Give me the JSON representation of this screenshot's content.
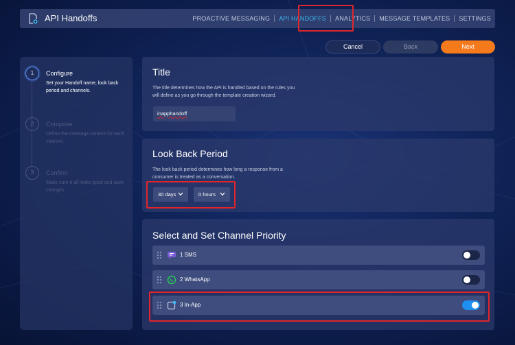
{
  "app": {
    "title": "API Handoffs",
    "icon": "document-plus-icon"
  },
  "nav": {
    "items": [
      {
        "label": "PROACTIVE MESSAGING",
        "active": false
      },
      {
        "label": "API HANDOFFS",
        "active": true
      },
      {
        "label": "ANALYTICS",
        "active": false
      },
      {
        "label": "MESSAGE TEMPLATES",
        "active": false
      },
      {
        "label": "SETTINGS",
        "active": false
      }
    ]
  },
  "actions": {
    "cancel": "Cancel",
    "back": "Back",
    "next": "Next"
  },
  "steps": [
    {
      "number": "1",
      "title": "Configure",
      "description": "Set your Handoff name, look back period and channels.",
      "active": true
    },
    {
      "number": "2",
      "title": "Compose",
      "description": "Define the message content for each channel.",
      "active": false
    },
    {
      "number": "3",
      "title": "Confirm",
      "description": "Make sure it all looks good and save changes.",
      "active": false
    }
  ],
  "title_card": {
    "heading": "Title",
    "description": "The title determines how the API is handled based on the rules you will define as you go through the template creation wizard.",
    "value": "inapphandoff"
  },
  "lookback_card": {
    "heading": "Look Back Period",
    "description": "The look back period determines how long a response from a consumer is treated as a conversation.",
    "days": "30 days",
    "hours": "0 hours"
  },
  "channels_card": {
    "heading": "Select and Set Channel Priority",
    "channels": [
      {
        "label": "1 SMS",
        "icon": "sms-chat-icon",
        "enabled": false
      },
      {
        "label": "2 WhatsApp",
        "icon": "whatsapp-icon",
        "enabled": false
      },
      {
        "label": "3 In-App",
        "icon": "in-app-icon",
        "enabled": true
      }
    ]
  },
  "colors": {
    "accent": "#3fb8f0",
    "primary": "#f47a1c",
    "toggle_on": "#1e8ef0",
    "highlight": "#e0262b"
  }
}
